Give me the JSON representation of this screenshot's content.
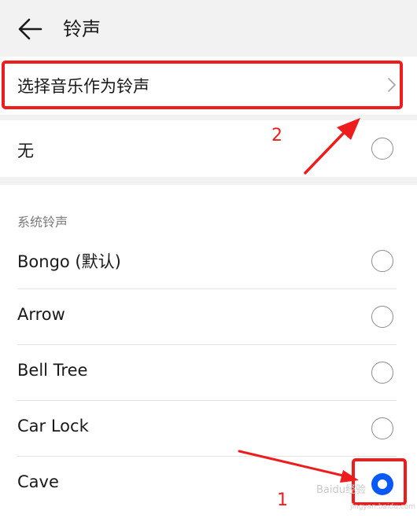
{
  "header": {
    "title": "铃声",
    "back_icon": "back-arrow-icon"
  },
  "music_option": {
    "label": "选择音乐作为铃声",
    "icon": "chevron-right-icon"
  },
  "none_option": {
    "label": "无",
    "selected": false
  },
  "system_section": {
    "label": "系统铃声",
    "items": [
      {
        "label": "Bongo (默认)",
        "selected": false
      },
      {
        "label": "Arrow",
        "selected": false
      },
      {
        "label": "Bell Tree",
        "selected": false
      },
      {
        "label": "Car Lock",
        "selected": false
      },
      {
        "label": "Cave",
        "selected": true
      }
    ]
  },
  "annotations": {
    "step1": "1",
    "step2": "2",
    "color": "#ee1c1c"
  },
  "watermark": {
    "text": "Baidu经验",
    "sub": "jingyan.baidu.com"
  },
  "colors": {
    "accent": "#0a59f7",
    "background": "#f2f2f2"
  }
}
